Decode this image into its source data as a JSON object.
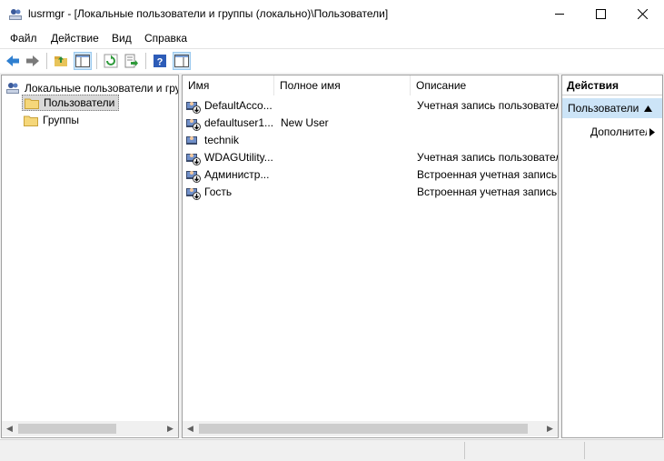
{
  "window": {
    "title": "lusrmgr - [Локальные пользователи и группы (локально)\\Пользователи]",
    "icon": "users-console-icon"
  },
  "menu": {
    "items": [
      {
        "label": "Файл"
      },
      {
        "label": "Действие"
      },
      {
        "label": "Вид"
      },
      {
        "label": "Справка"
      }
    ]
  },
  "toolbar": {
    "buttons": [
      "back-arrow-icon",
      "forward-arrow-icon",
      "up-folder-icon",
      "show-hide-tree-icon",
      "refresh-icon",
      "export-list-icon",
      "help-icon",
      "show-hide-action-pane-icon"
    ]
  },
  "tree": {
    "root_label": "Локальные пользователи и группы (локально)",
    "items": [
      {
        "label": "Пользователи",
        "selected": true
      },
      {
        "label": "Группы",
        "selected": false
      }
    ]
  },
  "list": {
    "columns": [
      "Имя",
      "Полное имя",
      "Описание"
    ],
    "rows": [
      {
        "name": "DefaultAcco...",
        "full_name": "",
        "description": "Учетная запись пользователя, управляемая системой.",
        "disabled": true
      },
      {
        "name": "defaultuser1...",
        "full_name": "New User",
        "description": "",
        "disabled": true
      },
      {
        "name": "technik",
        "full_name": "",
        "description": "",
        "disabled": false
      },
      {
        "name": "WDAGUtility...",
        "full_name": "",
        "description": "Учетная запись пользователя, управляемая и используемая системой для сценариев Application Guard в Защитнике Windows.",
        "disabled": true
      },
      {
        "name": "Администр...",
        "full_name": "",
        "description": "Встроенная учетная запись администратора компьютера/домена",
        "disabled": true
      },
      {
        "name": "Гость",
        "full_name": "",
        "description": "Встроенная учетная запись для доступа гостей к компьютеру или домену",
        "disabled": true
      }
    ]
  },
  "actions": {
    "title": "Действия",
    "section_label": "Пользователи",
    "more_label": "Дополнительные действия"
  },
  "colors": {
    "accent_selection": "#cce4f7",
    "tree_selection": "#d9d9d9"
  }
}
